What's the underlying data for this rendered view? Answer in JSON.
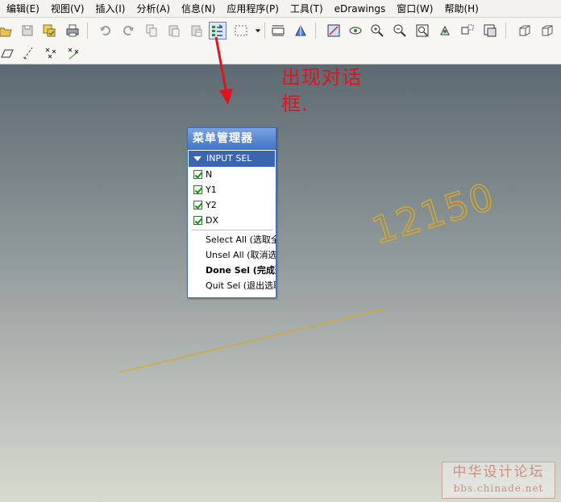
{
  "menubar": {
    "items": [
      {
        "label": "编辑(E)"
      },
      {
        "label": "视图(V)"
      },
      {
        "label": "插入(I)"
      },
      {
        "label": "分析(A)"
      },
      {
        "label": "信息(N)"
      },
      {
        "label": "应用程序(P)"
      },
      {
        "label": "工具(T)"
      },
      {
        "label": "eDrawings"
      },
      {
        "label": "窗口(W)"
      },
      {
        "label": "帮助(H)"
      }
    ]
  },
  "toolbar": {
    "icons": [
      "open-folder-icon",
      "save-icon",
      "save-as-icon",
      "print-icon",
      "undo-icon",
      "redo-icon",
      "copy-icon",
      "paste-icon",
      "paste-special-icon",
      "regenerate-icon",
      "select-box-icon",
      "dropdown-arrow-icon",
      "dimension-icon",
      "shaded-icon",
      "named-view-icon",
      "spin-center-icon",
      "zoom-in-icon",
      "zoom-out-icon",
      "refit-icon",
      "orient-icon",
      "saved-views-icon",
      "layers-icon",
      "box-icon",
      "box-alt-icon",
      "datum-plane-icon",
      "datum-axis-icon",
      "datum-point-icon",
      "coordinate-system-icon"
    ]
  },
  "annotation": {
    "text": "出现对话框."
  },
  "dimension": {
    "value": "12150"
  },
  "menu_manager": {
    "title": "菜单管理器",
    "section": "INPUT SEL",
    "checkboxes": [
      {
        "label": "N",
        "checked": true
      },
      {
        "label": "Y1",
        "checked": true
      },
      {
        "label": "Y2",
        "checked": true
      },
      {
        "label": "DX",
        "checked": true
      }
    ],
    "commands": [
      {
        "label": "Select All (选取全"
      },
      {
        "label": "Unsel All (取消选"
      },
      {
        "label": "Done Sel (完成选"
      },
      {
        "label": "Quit Sel (退出选取"
      }
    ]
  },
  "watermark": {
    "line1": "中华设计论坛",
    "line2": "bbs.chinade.net"
  },
  "colors": {
    "annotation": "#e0141e",
    "dimension": "#d9a827",
    "dialog_title": "#3f74c9"
  }
}
